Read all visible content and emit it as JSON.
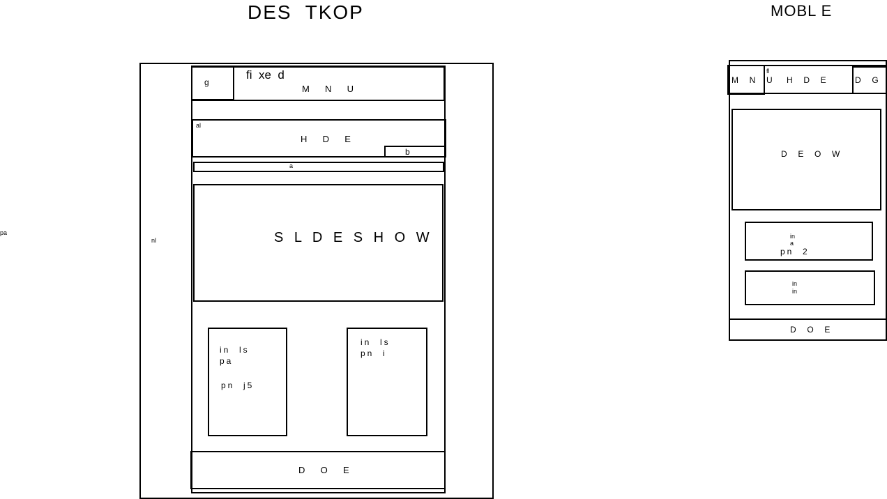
{
  "headings": {
    "desktop": "DES  TKOP",
    "mobile": "MOBL E"
  },
  "desktop": {
    "left_note": "pa",
    "margin_note": "nl",
    "fixed": "fi  xe  d",
    "logo": "g",
    "menu": "M  N  U",
    "header_tag": "al",
    "header": "H  D  E",
    "header_sub": "b",
    "bar_label": "a",
    "slideshow": "S L D E S H O W",
    "card1": [
      "in  ls",
      "pa",
      "pn  j5"
    ],
    "card2": [
      "in  ls",
      "pn  i"
    ],
    "footer": "D  O  E"
  },
  "mobile": {
    "menu": "M  N  U",
    "header_tag": "fl",
    "header": "H  D  E",
    "logo": "D  G  I",
    "slideshow": "D  E  O  W",
    "card1": [
      "in",
      "a",
      "pn  2"
    ],
    "card2": [
      "in",
      "in"
    ],
    "footer": "D  O  E"
  }
}
